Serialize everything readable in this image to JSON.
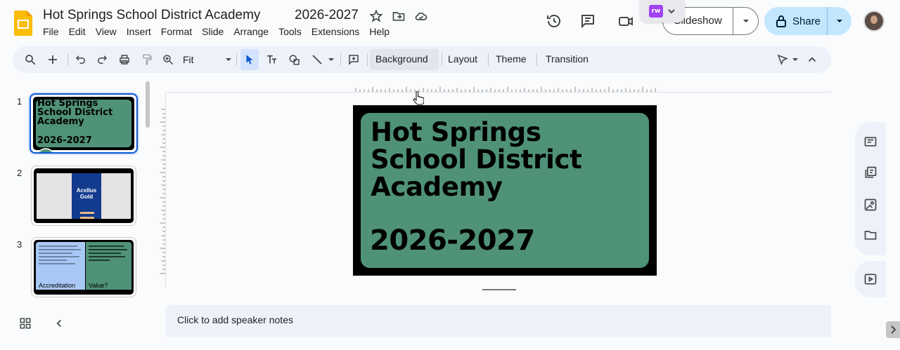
{
  "app": {
    "doc_title": "Hot Springs School District Academy",
    "doc_year": "2026-2027",
    "brand_color": "#fbbc04",
    "icons": [
      "star-icon",
      "move-to-folder-icon",
      "cloud-saved-icon"
    ]
  },
  "menu": [
    "File",
    "Edit",
    "View",
    "Insert",
    "Format",
    "Slide",
    "Arrange",
    "Tools",
    "Extensions",
    "Help"
  ],
  "header": {
    "slideshow_label": "Slideshow",
    "share_label": "Share",
    "share_color": "#c2e7ff",
    "extension_badge": "rw"
  },
  "toolbar": {
    "zoom_value": "Fit",
    "background_label": "Background",
    "layout_label": "Layout",
    "theme_label": "Theme",
    "transition_label": "Transition"
  },
  "filmstrip": {
    "slides": [
      {
        "number": "1",
        "title": "Hot Springs School District Academy",
        "subtitle": "2026-2027",
        "selected": true
      },
      {
        "number": "2",
        "title": "Acellus Gold"
      },
      {
        "number": "3",
        "left_label": "Accreditation",
        "right_label": "Value?"
      }
    ]
  },
  "slide": {
    "title": "Hot Springs\nSchool District\nAcademy",
    "subtitle": "2026-2027",
    "card_color": "#4f9277",
    "frame_color": "#000000"
  },
  "notes": {
    "placeholder": "Click to add speaker notes"
  }
}
